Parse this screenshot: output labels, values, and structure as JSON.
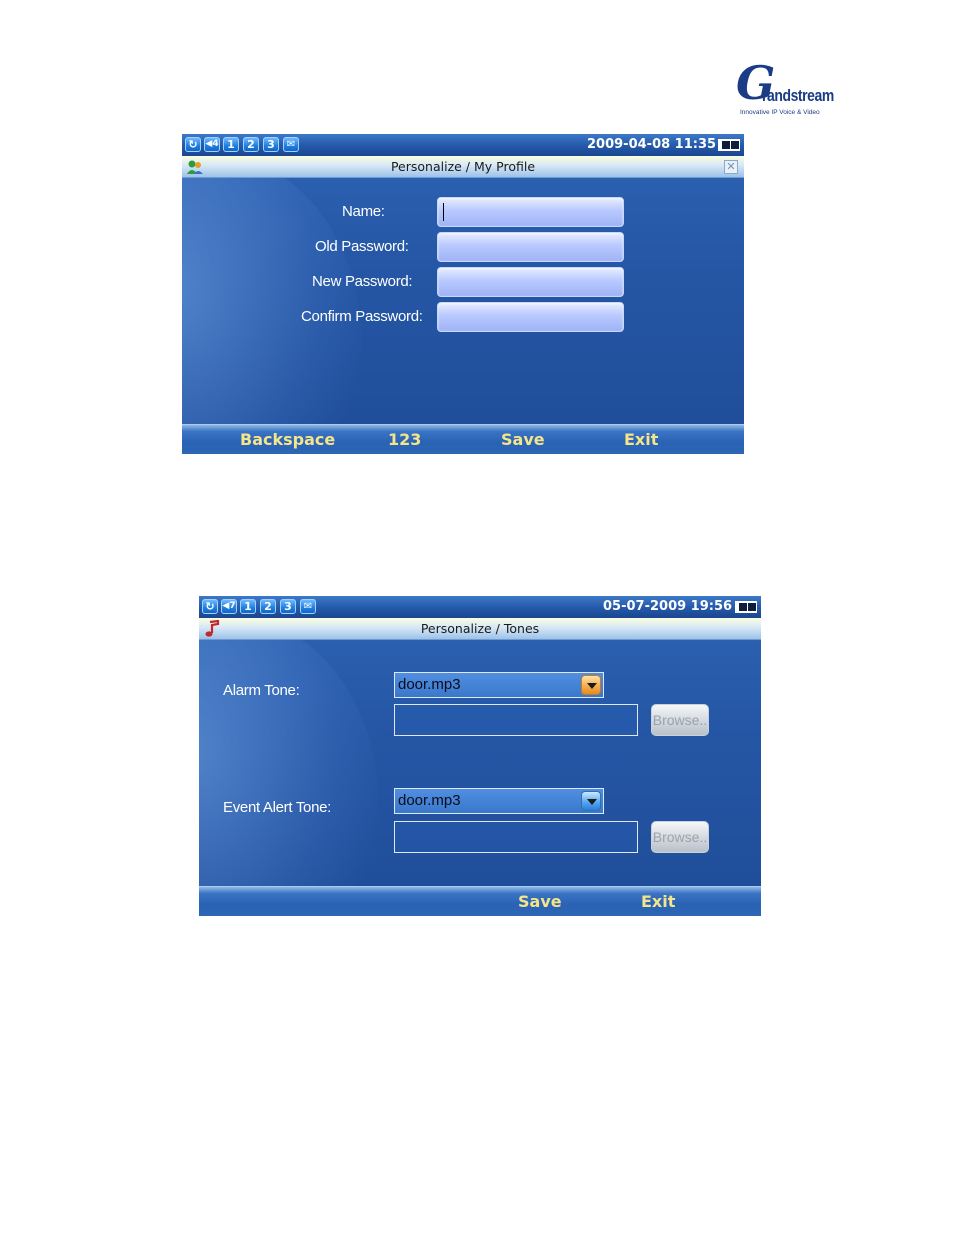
{
  "logo": {
    "letter": "G",
    "wordmark": "randstream",
    "tagline": "Innovative IP Voice & Video"
  },
  "screen1": {
    "status": {
      "icons": [
        "refresh-icon",
        "volume-icon",
        "line-1",
        "line-2",
        "line-3",
        "message-icon"
      ],
      "line_labels": [
        "1",
        "2",
        "3"
      ],
      "clock": "2009-04-08 11:35"
    },
    "title": "Personalize / My Profile",
    "fields": [
      {
        "label": "Name:",
        "value": ""
      },
      {
        "label": "Old Password:",
        "value": ""
      },
      {
        "label": "New Password:",
        "value": ""
      },
      {
        "label": "Confirm Password:",
        "value": ""
      }
    ],
    "softkeys": [
      "Backspace",
      "123",
      "Save",
      "Exit"
    ]
  },
  "screen2": {
    "status": {
      "line_labels": [
        "1",
        "2",
        "3"
      ],
      "clock": "05-07-2009 19:56"
    },
    "title": "Personalize / Tones",
    "alarm": {
      "label": "Alarm Tone:",
      "selected": "door.mp3",
      "path": "",
      "browse_label": "Browse.."
    },
    "event": {
      "label": "Event Alert Tone:",
      "selected": "door.mp3",
      "path": "",
      "browse_label": "Browse.."
    },
    "softkeys": [
      "Save",
      "Exit"
    ]
  },
  "colors": {
    "softkey_text": "#f4e48a",
    "screen_bg": "#2557a6",
    "input_fill": "#b9c9ff",
    "logo_blue": "#1a3c86"
  }
}
